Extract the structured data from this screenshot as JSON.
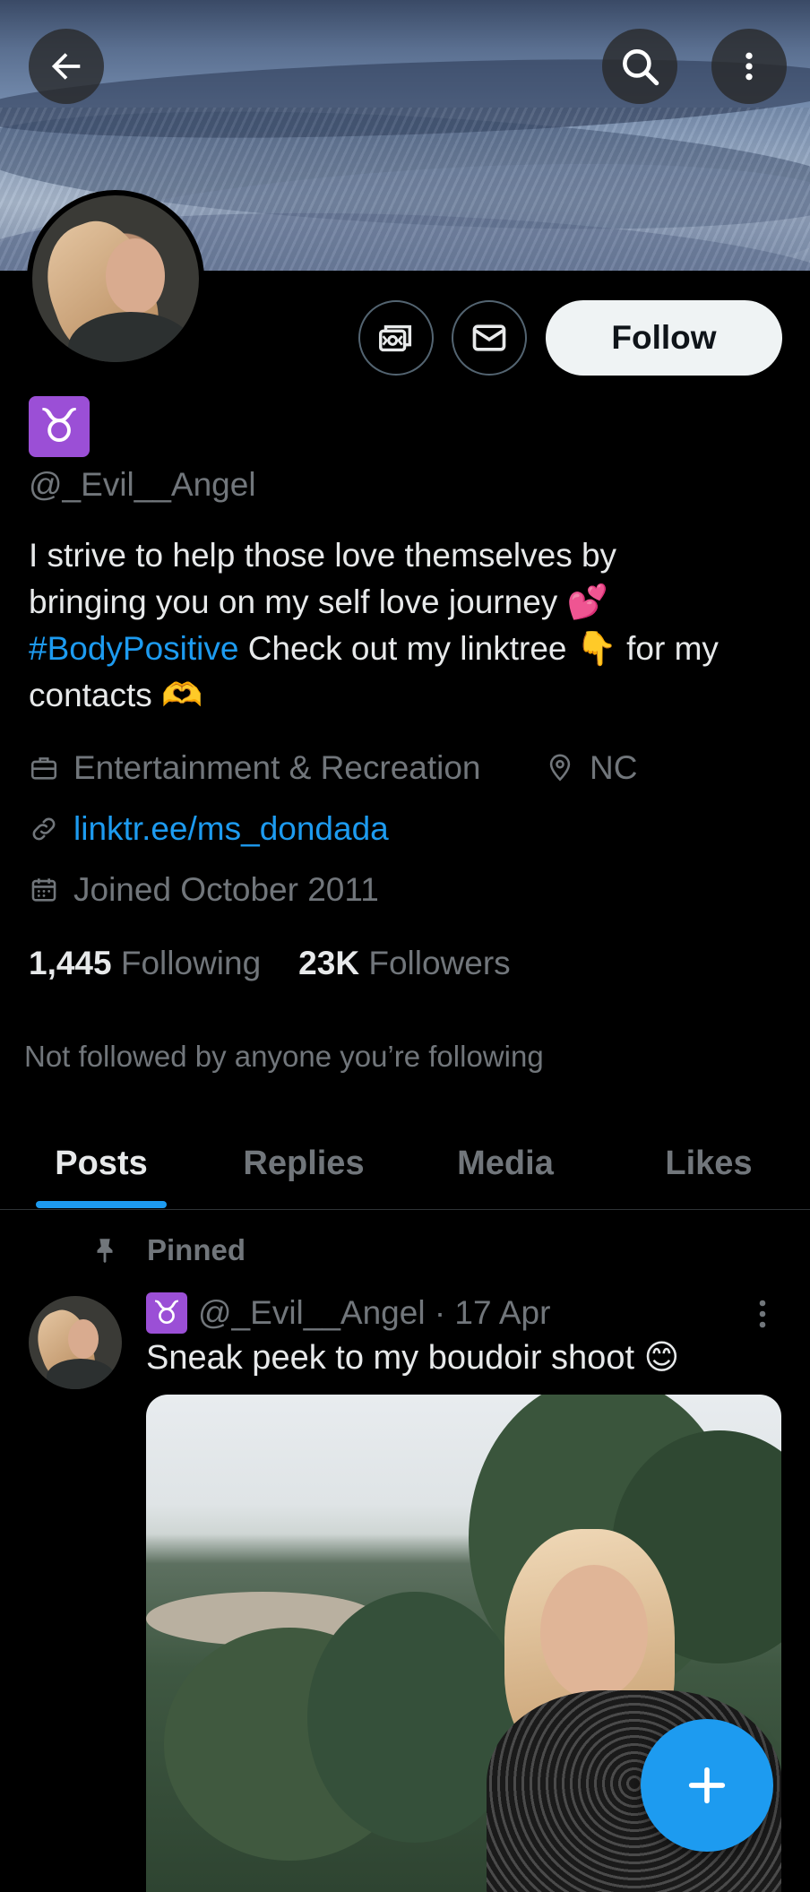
{
  "profile": {
    "zodiac": "♉",
    "handle": "@_Evil__Angel",
    "bio": {
      "line1": "I strive to help those love themselves by",
      "line2": "bringing you on my self love journey",
      "line2_emoji": "💕",
      "hashtag": "#BodyPositive",
      "after_hashtag": " Check out my linktree ",
      "point_emoji": "👇",
      "after_point": " for my",
      "line4": "contacts ",
      "hands_emoji": "🫶"
    },
    "category": "Entertainment & Recreation",
    "location": "NC",
    "website": "linktr.ee/ms_dondada",
    "joined": "Joined October 2011",
    "following_count": "1,445",
    "following_label": "Following",
    "followers_count": "23K",
    "followers_label": "Followers",
    "not_followed_text": "Not followed by anyone you’re following"
  },
  "actions": {
    "follow_label": "Follow"
  },
  "tabs": [
    {
      "label": "Posts",
      "active": true
    },
    {
      "label": "Replies",
      "active": false
    },
    {
      "label": "Media",
      "active": false
    },
    {
      "label": "Likes",
      "active": false
    }
  ],
  "pinned_post": {
    "pinned_label": "Pinned",
    "zodiac": "♉",
    "meta": "@_Evil__Angel · 17 Apr",
    "text": "Sneak peek to my boudoir shoot ",
    "text_emoji": "😊"
  },
  "icons": {
    "back": "arrow-left-icon",
    "search": "search-icon",
    "more": "more-vertical-icon",
    "subscribe": "subscribe-icon",
    "message": "envelope-icon",
    "category": "briefcase-icon",
    "location": "location-pin-icon",
    "link": "link-icon",
    "calendar": "calendar-icon",
    "pin": "pin-icon",
    "compose": "plus-icon"
  },
  "colors": {
    "background": "#000000",
    "accent": "#1d9bf0",
    "muted": "#71767b",
    "text": "#e7e9ea",
    "zodiac_bg": "#9b4fd6"
  }
}
